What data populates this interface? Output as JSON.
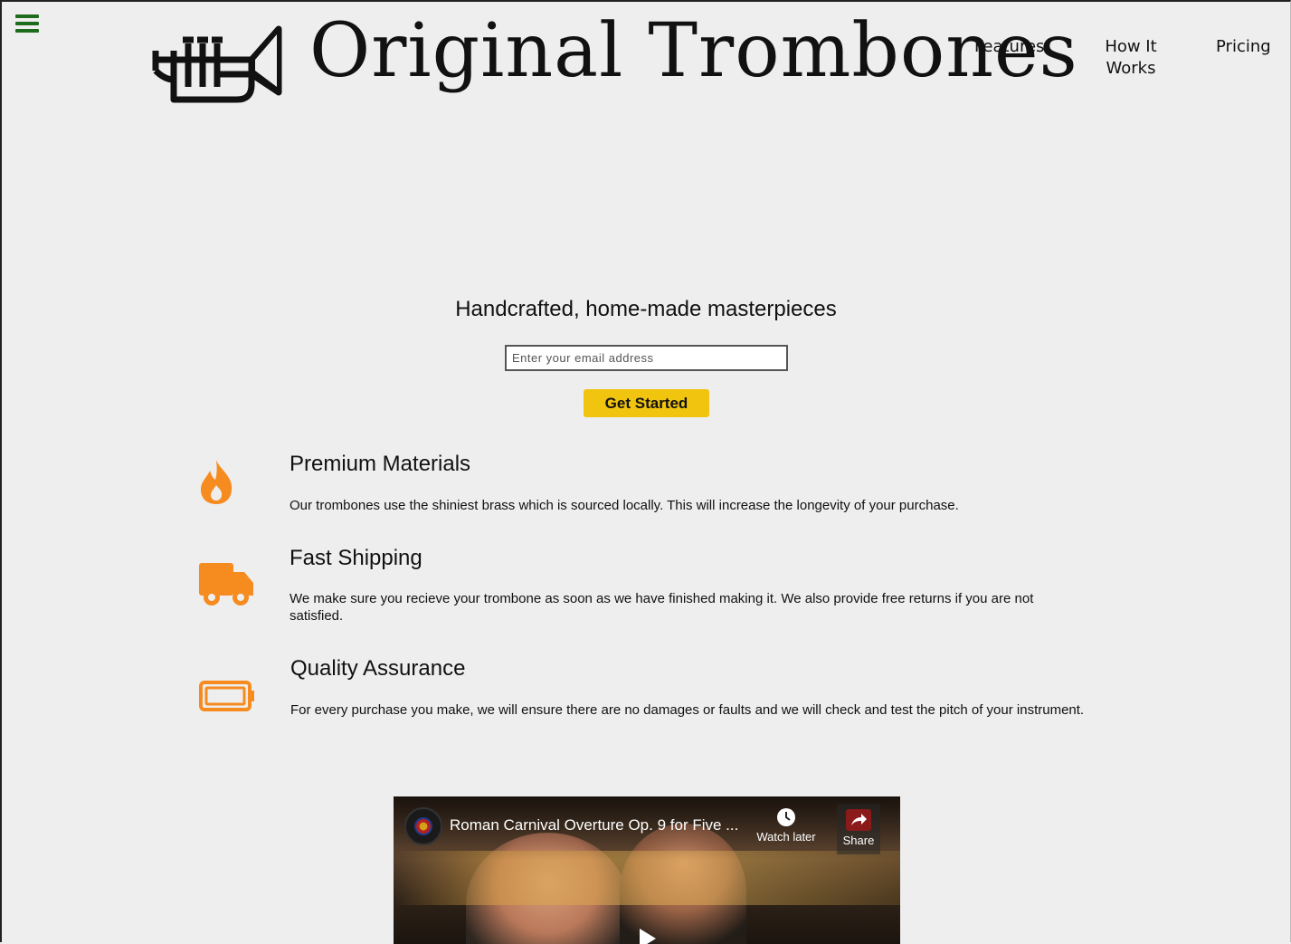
{
  "header": {
    "menu_icon": "hamburger-icon",
    "logo_icon": "trumpet-icon",
    "brand": "Original Trombones",
    "nav": [
      {
        "label": "Features"
      },
      {
        "label": "How It Works"
      },
      {
        "label": "Pricing"
      }
    ]
  },
  "hero": {
    "headline": "Handcrafted, home-made masterpieces",
    "email_placeholder": "Enter your email address",
    "cta_label": "Get Started"
  },
  "features": [
    {
      "icon": "fire-icon",
      "title": "Premium Materials",
      "description": "Our trombones use the shiniest brass which is sourced locally. This will increase the longevity of your purchase."
    },
    {
      "icon": "truck-icon",
      "title": "Fast Shipping",
      "description": "We make sure you recieve your trombone as soon as we have finished making it. We also provide free returns if you are not satisfied."
    },
    {
      "icon": "battery-icon",
      "title": "Quality Assurance",
      "description": "For every purchase you make, we will ensure there are no damages or faults and we will check and test the pitch of your instrument."
    }
  ],
  "video": {
    "title": "Roman Carnival Overture Op. 9 for Five ...",
    "watch_later_label": "Watch later",
    "share_label": "Share"
  },
  "colors": {
    "accent_orange": "#f68b1f",
    "cta_yellow": "#f1c40f",
    "menu_green": "#1d6b1d",
    "background": "#eeeeee"
  }
}
